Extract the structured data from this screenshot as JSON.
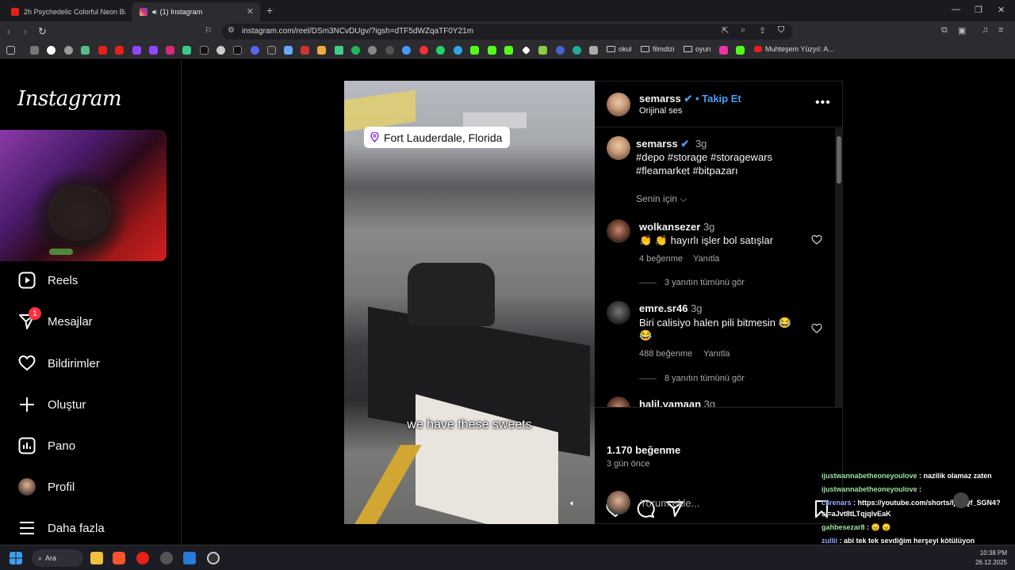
{
  "browser": {
    "tabs": [
      {
        "title": "2h Psychedelic Colorful Neon Backgr",
        "active": false,
        "favicon_color": "#e62117"
      },
      {
        "title": "(1) Instagram",
        "active": true,
        "favicon_color": "#d62976"
      }
    ],
    "url": "instagram.com/reel/DSm3NCvDUgv/?igsh=dTF5dWZqaTF0Y21m",
    "bookmarks": [
      {
        "label": "okul"
      },
      {
        "label": "filmdizi"
      },
      {
        "label": "oyun"
      },
      {
        "label": "Muhteşem Yüzyıl: A..."
      }
    ]
  },
  "instagram": {
    "logo": "Instagram",
    "nav": [
      {
        "label": "Reels",
        "icon": "reels-icon"
      },
      {
        "label": "Mesajlar",
        "icon": "messenger-icon",
        "badge": "1"
      },
      {
        "label": "Bildirimler",
        "icon": "heart-icon"
      },
      {
        "label": "Oluştur",
        "icon": "plus-icon"
      },
      {
        "label": "Pano",
        "icon": "dashboard-icon"
      },
      {
        "label": "Profil",
        "icon": "avatar"
      },
      {
        "label": "Daha fazla",
        "icon": "menu-icon"
      }
    ]
  },
  "reel": {
    "location": "Fort Lauderdale, Florida",
    "subtitle": "we have these sweets"
  },
  "post": {
    "author": "semarss",
    "follow": "Takip Et",
    "audio": "Orijinal ses",
    "caption_time": "3g",
    "caption_line1": "#depo #storage #storagewars",
    "caption_line2": "#fleamarket #bitpazarı",
    "for_you": "Senin için",
    "comments": [
      {
        "user": "wolkansezer",
        "time": "3g",
        "text": "👏 👏  hayırlı işler bol satışlar",
        "likes": "4 beğenme",
        "reply": "Yanıtla",
        "view_replies": "3 yanıtın tümünü gör"
      },
      {
        "user": "emre.sr46",
        "time": "3g",
        "text": "Biri calisiyo halen pili bitmesin 😂",
        "text2": "😂",
        "likes": "488 beğenme",
        "reply": "Yanıtla",
        "view_replies": "8 yanıtın tümünü gör"
      },
      {
        "user": "halil.yamaan",
        "time": "3g"
      }
    ],
    "likes": "1.170 beğenme",
    "posted": "3 gün önce",
    "comment_placeholder": "Yorum ekle..."
  },
  "chat": [
    {
      "user": "ijustwannabetheoneyoulove",
      "text": ": nazilik olamaz zaten"
    },
    {
      "user": "ijustwannabetheoneyoulove",
      "text": ":"
    },
    {
      "user": "c3renars",
      "text": ": https://youtube.com/shorts/ljC8Qf_SGN4?si=aJvt8tLTqjqlvEaK"
    },
    {
      "user": "gahbesezar8",
      "text": ": 😠 😠"
    },
    {
      "user": "zullii",
      "text": ": abi tek tek sevdiğim herşeyi kötülüyon korkuyorum"
    }
  ],
  "taskbar": {
    "search": "Ara",
    "time": "10:38 PM",
    "date": "26.12.2025"
  }
}
